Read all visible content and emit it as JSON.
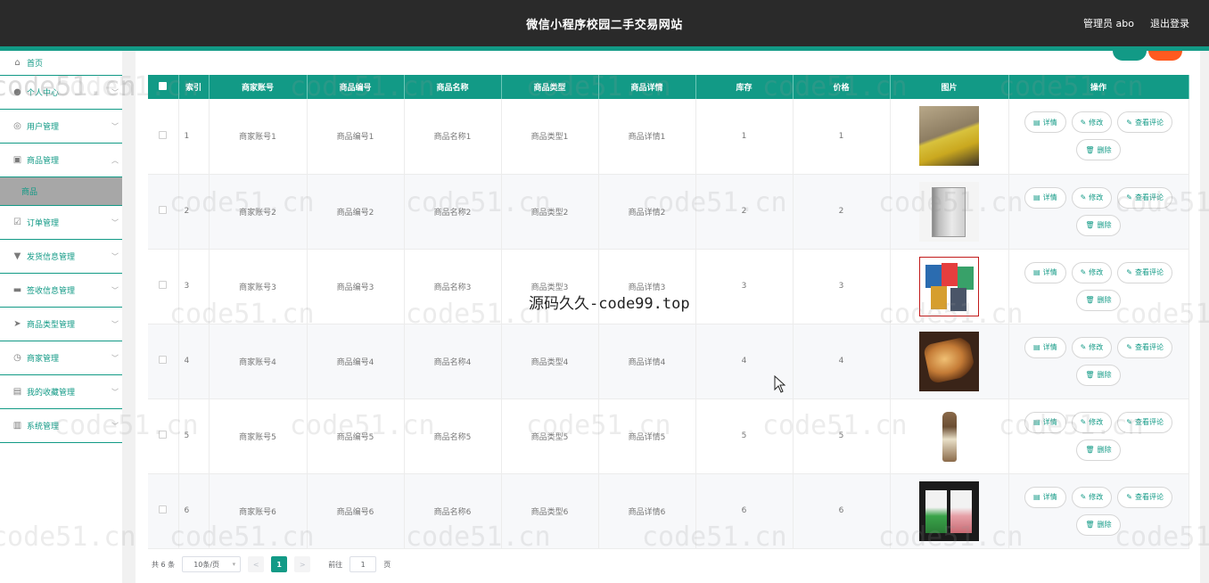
{
  "header": {
    "title": "微信小程序校园二手交易网站",
    "user": "管理员 abo",
    "logout": "退出登录"
  },
  "sidebar": {
    "items": [
      {
        "label": "首页",
        "icon": "home-icon",
        "glyph": "⌂"
      },
      {
        "label": "个人中心",
        "icon": "user-icon",
        "glyph": "●"
      },
      {
        "label": "用户管理",
        "icon": "users-icon",
        "glyph": "◎"
      },
      {
        "label": "商品管理",
        "icon": "goods-icon",
        "glyph": "▣"
      },
      {
        "label": "订单管理",
        "icon": "order-icon",
        "glyph": "☑"
      },
      {
        "label": "发货信息管理",
        "icon": "shipping-icon",
        "glyph": "▼"
      },
      {
        "label": "签收信息管理",
        "icon": "receipt-icon",
        "glyph": "▬"
      },
      {
        "label": "商品类型管理",
        "icon": "category-icon",
        "glyph": "➤"
      },
      {
        "label": "商家管理",
        "icon": "merchant-icon",
        "glyph": "◷"
      },
      {
        "label": "我的收藏管理",
        "icon": "favorites-icon",
        "glyph": "▤"
      },
      {
        "label": "系统管理",
        "icon": "system-icon",
        "glyph": "▥"
      }
    ],
    "submenu_label": "商品"
  },
  "table": {
    "columns": [
      "索引",
      "商家账号",
      "商品编号",
      "商品名称",
      "商品类型",
      "商品详情",
      "库存",
      "价格",
      "图片",
      "操作"
    ],
    "rows": [
      {
        "index": "1",
        "account": "商家账号1",
        "code": "商品编号1",
        "name": "商品名称1",
        "type": "商品类型1",
        "detail": "商品详情1",
        "stock": "1",
        "price": "1",
        "image": "clothing-photo"
      },
      {
        "index": "2",
        "account": "商家账号2",
        "code": "商品编号2",
        "name": "商品名称2",
        "type": "商品类型2",
        "detail": "商品详情2",
        "stock": "2",
        "price": "2",
        "image": "book-photo"
      },
      {
        "index": "3",
        "account": "商家账号3",
        "code": "商品编号3",
        "name": "商品名称3",
        "type": "商品类型3",
        "detail": "商品详情3",
        "stock": "3",
        "price": "3",
        "image": "snacks-photo"
      },
      {
        "index": "4",
        "account": "商家账号4",
        "code": "商品编号4",
        "name": "商品名称4",
        "type": "商品类型4",
        "detail": "商品详情4",
        "stock": "4",
        "price": "4",
        "image": "food-photo"
      },
      {
        "index": "5",
        "account": "商家账号5",
        "code": "商品编号5",
        "name": "商品名称5",
        "type": "商品类型5",
        "detail": "商品详情5",
        "stock": "5",
        "price": "5",
        "image": "drink-photo"
      },
      {
        "index": "6",
        "account": "商家账号6",
        "code": "商品编号6",
        "name": "商品名称6",
        "type": "商品类型6",
        "detail": "商品详情6",
        "stock": "6",
        "price": "6",
        "image": "packaged-food-photo"
      }
    ],
    "actions": {
      "detail": "详情",
      "edit": "修改",
      "comments": "查看评论",
      "delete": "删除"
    }
  },
  "pagination": {
    "total": "共 6 条",
    "page_size": "10条/页",
    "current_page": "1",
    "jump_prefix": "前往",
    "jump_value": "1",
    "jump_suffix": "页",
    "prev": "<",
    "next": ">"
  },
  "watermarks": {
    "repeat": "code51.cn",
    "center": "源码久久-code99.top"
  },
  "colors": {
    "accent": "#129a86",
    "header_bg": "#2a2a2a",
    "danger": "#ff5a1f"
  }
}
